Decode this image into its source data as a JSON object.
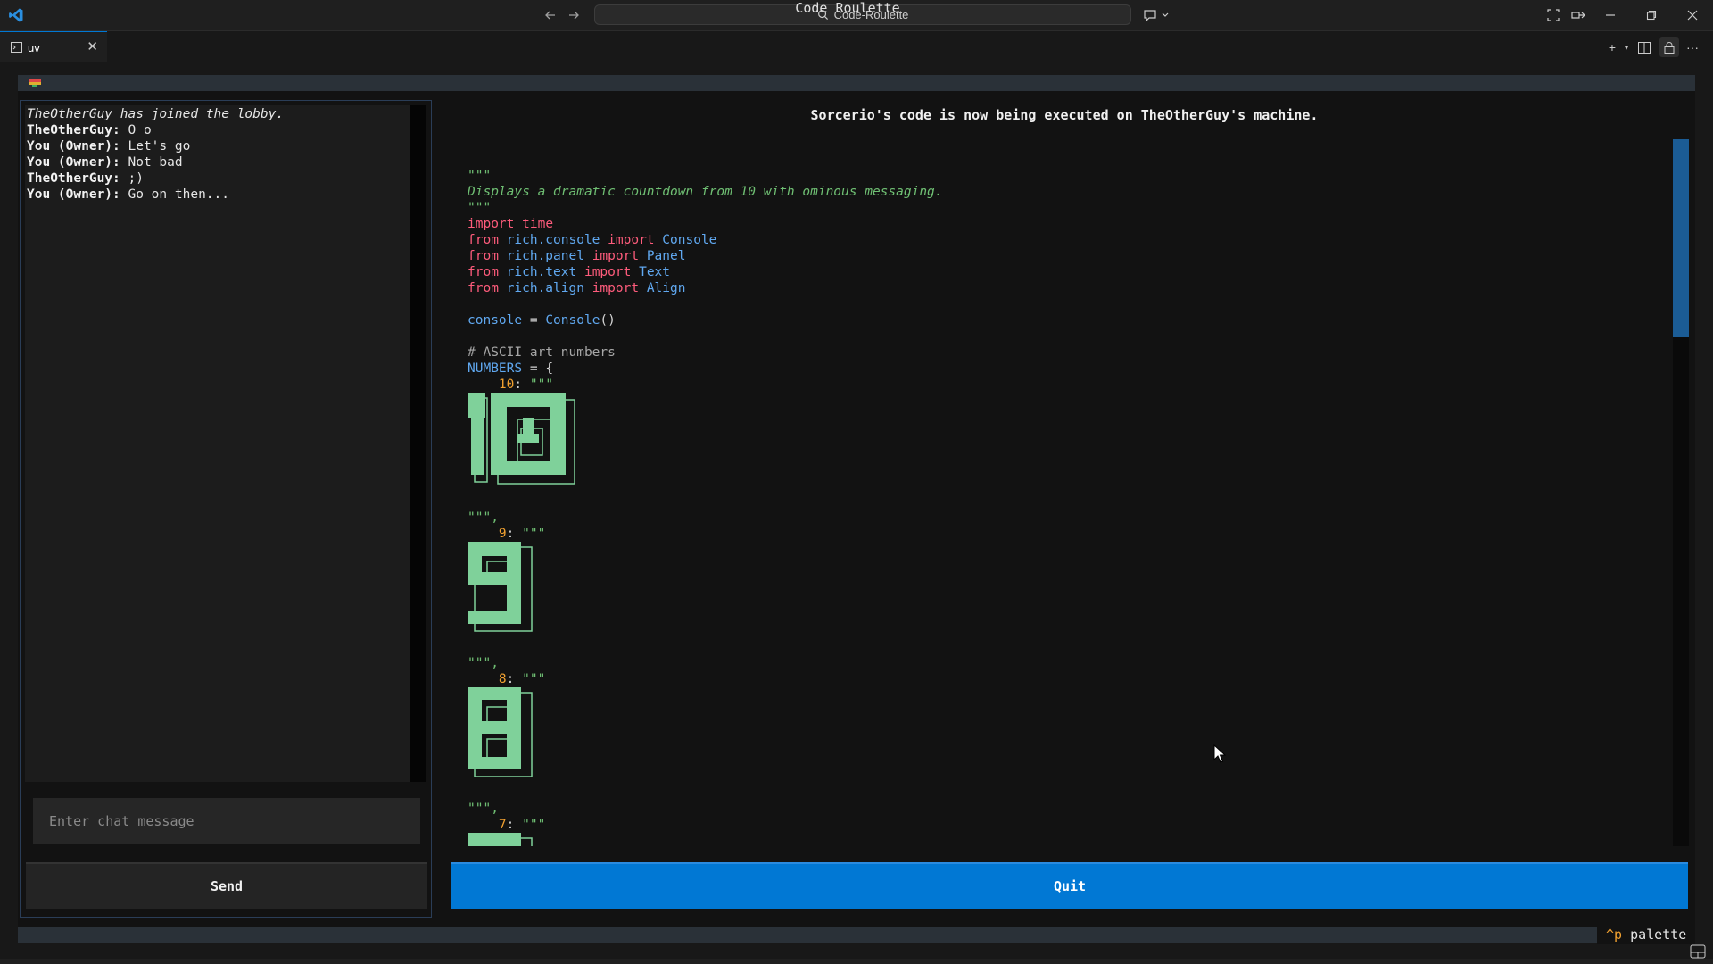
{
  "titlebar": {
    "search_text": "Code-Roulette"
  },
  "tab": {
    "label": "uv"
  },
  "app": {
    "title": "Code Roulette"
  },
  "chat": {
    "messages": [
      {
        "type": "system",
        "text": "TheOtherGuy has joined the lobby."
      },
      {
        "type": "user",
        "author": "TheOtherGuy:",
        "text": " O_o"
      },
      {
        "type": "user",
        "author": "You (Owner):",
        "text": " Let's go"
      },
      {
        "type": "user",
        "author": "You (Owner):",
        "text": " Not bad"
      },
      {
        "type": "user",
        "author": "TheOtherGuy:",
        "text": " ;)"
      },
      {
        "type": "user",
        "author": "You (Owner):",
        "text": " Go on then..."
      }
    ],
    "input_placeholder": "Enter chat message",
    "send_label": "Send"
  },
  "execution": {
    "banner": "Sorcerio's code is now being executed on TheOtherGuy's machine.",
    "quit_label": "Quit"
  },
  "code": {
    "docstring_quote": "\"\"\"",
    "docstring_text": "Displays a dramatic countdown from 10 with ominous messaging.",
    "kw_import": "import",
    "kw_from": "from",
    "mod_time": "time",
    "mod_console": "rich.console",
    "mod_panel": "rich.panel",
    "mod_text": "rich.text",
    "mod_align": "rich.align",
    "name_console": "Console",
    "name_panel": "Panel",
    "name_text": "Text",
    "name_align": "Align",
    "var_console": "console",
    "op_assign": " = ",
    "call_console": "Console",
    "parens": "()",
    "comment": "# ASCII art numbers",
    "var_numbers": "NUMBERS",
    "brace": "{",
    "key_10": "10",
    "key_9": "9",
    "key_8": "8",
    "key_7": "7",
    "colon": ": ",
    "close_quote": "\"\"\","
  },
  "footer": {
    "palette_key": "^p",
    "palette_label": " palette"
  },
  "colors": {
    "accent": "#0178d4",
    "string": "#6fbf73",
    "keyword": "#ff5c7c",
    "name": "#60a8f0",
    "number": "#f0a030"
  },
  "icons": [
    "vscode-logo-icon",
    "arrow-left-icon",
    "arrow-right-icon",
    "search-icon",
    "copilot-chat-icon",
    "layout-icon",
    "minimize-icon",
    "maximize-icon",
    "close-icon",
    "add-icon",
    "split-editor-icon",
    "lock-icon",
    "more-icon",
    "mouse-pointer-icon"
  ]
}
